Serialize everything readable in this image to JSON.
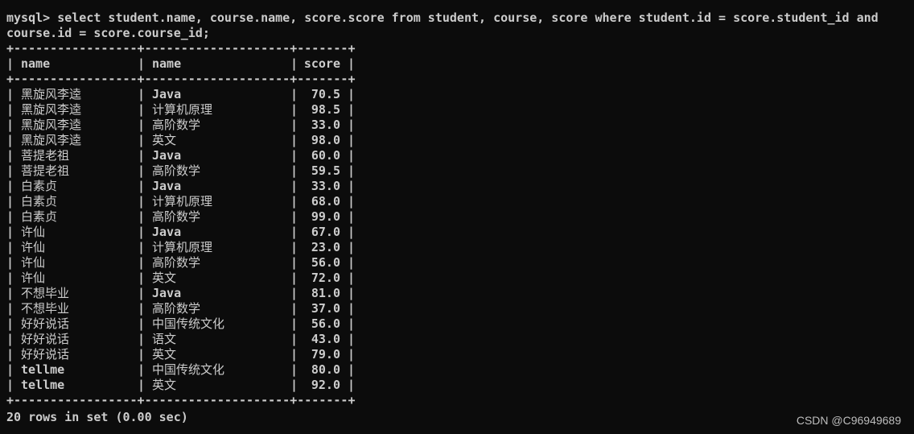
{
  "terminal": {
    "prompt": "mysql>",
    "command": "select student.name, course.name, score.score from student, course, score where student.id = score.student_id and course.id = score.course_id;",
    "border": "+-----------------+--------------------+-------+",
    "headers": [
      "name",
      "name",
      "score"
    ],
    "rows": [
      {
        "student": "黑旋风李逵",
        "course": "Java",
        "score": "70.5"
      },
      {
        "student": "黑旋风李逵",
        "course": "计算机原理",
        "score": "98.5"
      },
      {
        "student": "黑旋风李逵",
        "course": "高阶数学",
        "score": "33.0"
      },
      {
        "student": "黑旋风李逵",
        "course": "英文",
        "score": "98.0"
      },
      {
        "student": "菩提老祖",
        "course": "Java",
        "score": "60.0"
      },
      {
        "student": "菩提老祖",
        "course": "高阶数学",
        "score": "59.5"
      },
      {
        "student": "白素贞",
        "course": "Java",
        "score": "33.0"
      },
      {
        "student": "白素贞",
        "course": "计算机原理",
        "score": "68.0"
      },
      {
        "student": "白素贞",
        "course": "高阶数学",
        "score": "99.0"
      },
      {
        "student": "许仙",
        "course": "Java",
        "score": "67.0"
      },
      {
        "student": "许仙",
        "course": "计算机原理",
        "score": "23.0"
      },
      {
        "student": "许仙",
        "course": "高阶数学",
        "score": "56.0"
      },
      {
        "student": "许仙",
        "course": "英文",
        "score": "72.0"
      },
      {
        "student": "不想毕业",
        "course": "Java",
        "score": "81.0"
      },
      {
        "student": "不想毕业",
        "course": "高阶数学",
        "score": "37.0"
      },
      {
        "student": "好好说话",
        "course": "中国传统文化",
        "score": "56.0"
      },
      {
        "student": "好好说话",
        "course": "语文",
        "score": "43.0"
      },
      {
        "student": "好好说话",
        "course": "英文",
        "score": "79.0"
      },
      {
        "student": "tellme",
        "course": "中国传统文化",
        "score": "80.0"
      },
      {
        "student": "tellme",
        "course": "英文",
        "score": "92.0"
      }
    ],
    "result_summary": "20 rows in set (0.00 sec)"
  },
  "watermark": "CSDN @C96949689",
  "colors": {
    "background": "#0c0c0c",
    "text": "#cccccc"
  }
}
